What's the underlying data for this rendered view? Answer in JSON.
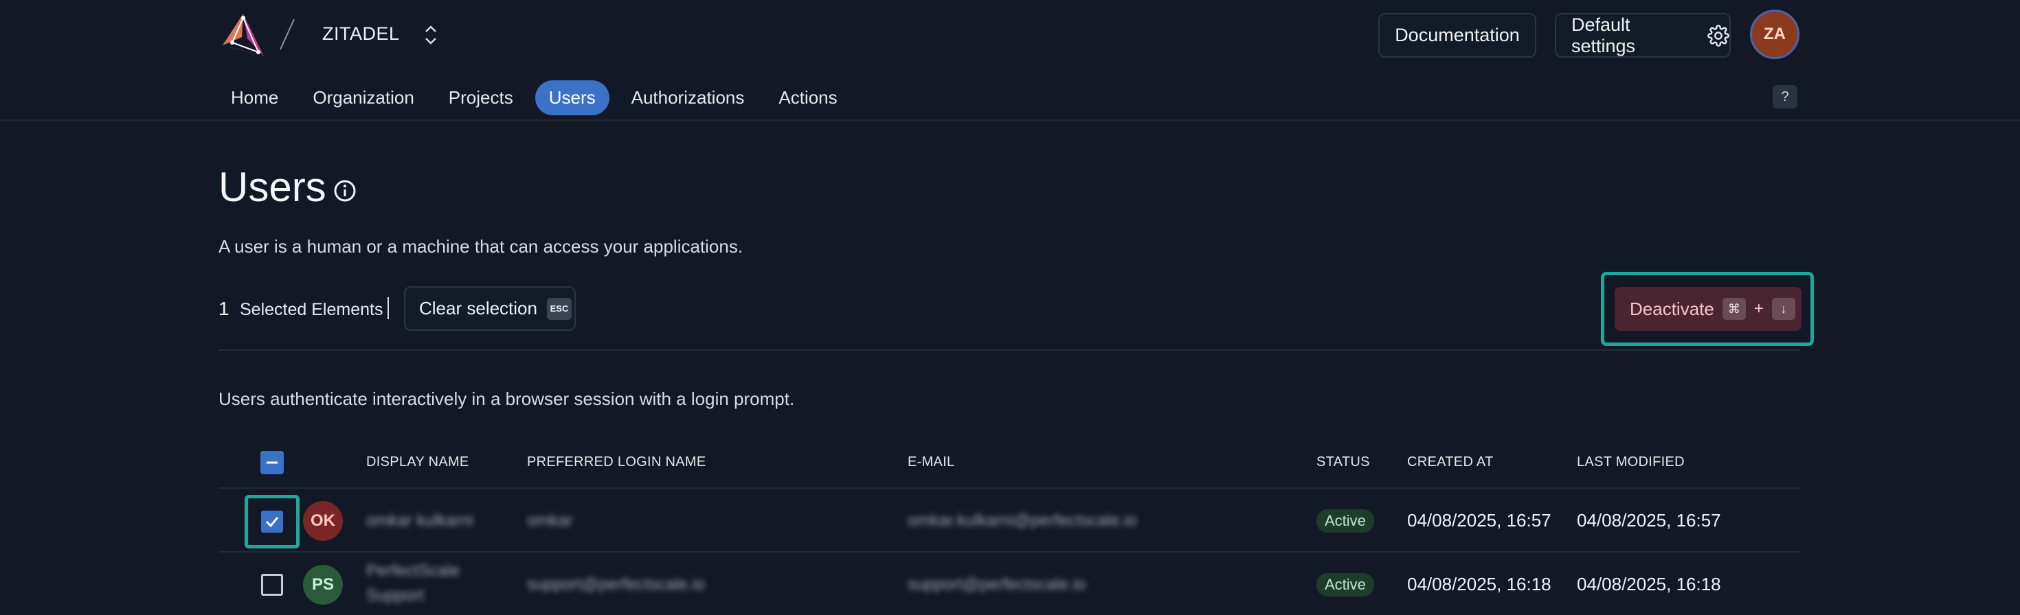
{
  "header": {
    "org_name": "ZITADEL",
    "documentation_label": "Documentation",
    "settings_label": "Default settings",
    "avatar_initials": "ZA",
    "help_label": "?"
  },
  "nav": {
    "items": [
      {
        "label": "Home"
      },
      {
        "label": "Organization"
      },
      {
        "label": "Projects"
      },
      {
        "label": "Users"
      },
      {
        "label": "Authorizations"
      },
      {
        "label": "Actions"
      }
    ],
    "active": "Users"
  },
  "page": {
    "title": "Users",
    "description": "A user is a human or a machine that can access your applications.",
    "type_description": "Users authenticate interactively in a browser session with a login prompt."
  },
  "selection": {
    "count": "1",
    "label": "Selected Elements",
    "clear_label": "Clear selection",
    "clear_key": "ESC",
    "deactivate_label": "Deactivate",
    "deactivate_key1": "⌘",
    "deactivate_plus": "+",
    "deactivate_key2": "↓"
  },
  "table": {
    "columns": [
      "DISPLAY NAME",
      "PREFERRED LOGIN NAME",
      "E-MAIL",
      "STATUS",
      "CREATED AT",
      "LAST MODIFIED"
    ],
    "rows": [
      {
        "selected": true,
        "initials": "OK",
        "display_name": "omkar kulkarni",
        "login_name": "omkar",
        "email": "omkar.kulkarni@perfectscale.io",
        "status": "Active",
        "created_at": "04/08/2025, 16:57",
        "last_modified": "04/08/2025, 16:57"
      },
      {
        "selected": false,
        "initials": "PS",
        "display_name_line1": "PerfectScale",
        "display_name_line2": "Support",
        "login_name": "support@perfectscale.io",
        "email": "support@perfectscale.io",
        "status": "Active",
        "created_at": "04/08/2025, 16:18",
        "last_modified": "04/08/2025, 16:18"
      }
    ]
  },
  "colors": {
    "background": "#121826",
    "accent": "#3b72c8",
    "highlight": "#1fa89a",
    "danger_bg": "#4a2430",
    "status_bg": "#1f3b2c"
  },
  "icons": [
    "zitadel-logo-icon",
    "chevron-updown-icon",
    "gear-icon",
    "info-icon",
    "check-icon",
    "minus-icon"
  ]
}
